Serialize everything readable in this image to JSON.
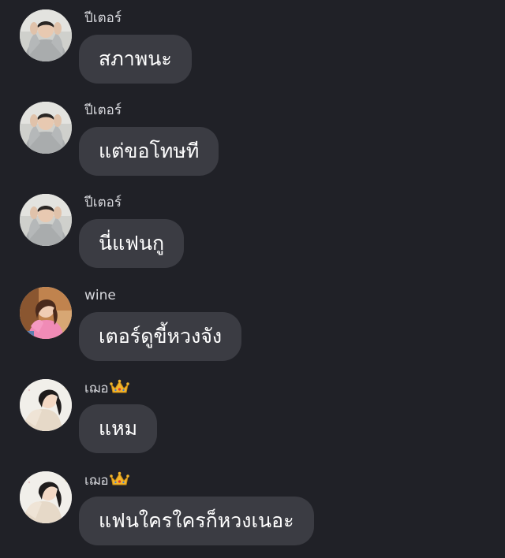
{
  "messages": [
    {
      "sender": "ปีเตอร์",
      "text": "สภาพนะ",
      "avatar": "hoodie-boy-avatar",
      "crown": false
    },
    {
      "sender": "ปีเตอร์",
      "text": "แต่ขอโทษที",
      "avatar": "hoodie-boy-avatar",
      "crown": false
    },
    {
      "sender": "ปีเตอร์",
      "text": "นี่แฟนกู",
      "avatar": "hoodie-boy-avatar",
      "crown": false
    },
    {
      "sender": "wine",
      "text": "เตอร์ดูขี้หวงจัง",
      "avatar": "pink-shirt-girl-avatar",
      "crown": false
    },
    {
      "sender": "เฌอ",
      "text": "แหม",
      "avatar": "sweater-girl-avatar",
      "crown": true,
      "crown_icon": "crown-icon"
    },
    {
      "sender": "เฌอ",
      "text": "แฟนใครใครก็หวงเนอะ",
      "avatar": "sweater-girl-avatar",
      "crown": true,
      "crown_icon": "crown-icon"
    }
  ],
  "colors": {
    "background": "#202127",
    "bubble": "#3b3c43",
    "sender_text": "#d7d8dd",
    "message_text": "#ffffff",
    "crown": "#f2b52c"
  }
}
